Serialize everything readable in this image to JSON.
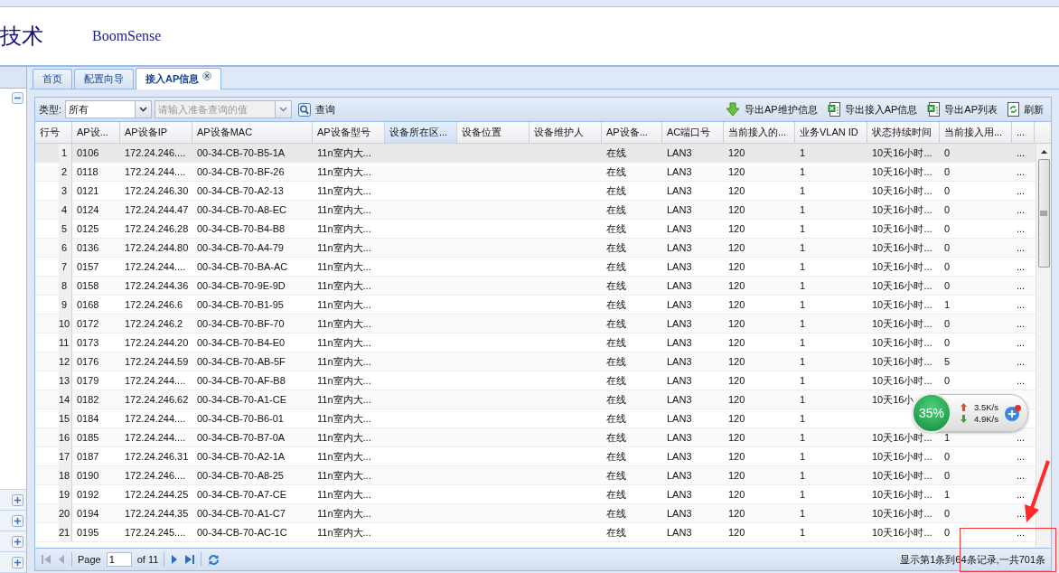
{
  "header": {
    "title": "技术",
    "brand": "BoomSense"
  },
  "sidebar": {
    "sections": [
      {
        "expanded": true
      },
      {
        "expanded": false
      },
      {
        "expanded": false
      },
      {
        "expanded": false
      },
      {
        "expanded": false
      }
    ]
  },
  "tabs": [
    {
      "label": "首页",
      "selected": false,
      "closable": false
    },
    {
      "label": "配置向导",
      "selected": false,
      "closable": false
    },
    {
      "label": "接入AP信息",
      "selected": true,
      "closable": true
    }
  ],
  "toolbar": {
    "type_label": "类型:",
    "type_value": "所有",
    "search_placeholder": "请输入准备查询的值",
    "search_button": "查询",
    "actions": [
      {
        "kind": "download",
        "label": "导出AP维护信息"
      },
      {
        "kind": "excel",
        "label": "导出接入AP信息"
      },
      {
        "kind": "excel",
        "label": "导出AP列表"
      },
      {
        "kind": "refresh",
        "label": "刷新"
      }
    ]
  },
  "table": {
    "columns": [
      {
        "label": "行号",
        "selected": false
      },
      {
        "label": "AP设...",
        "selected": false
      },
      {
        "label": "AP设备IP",
        "selected": false
      },
      {
        "label": "AP设备MAC",
        "selected": false
      },
      {
        "label": "AP设备型号",
        "selected": false
      },
      {
        "label": "设备所在区...",
        "selected": true
      },
      {
        "label": "设备位置",
        "selected": false
      },
      {
        "label": "设备维护人",
        "selected": false
      },
      {
        "label": "AP设备...",
        "selected": false
      },
      {
        "label": "AC端口号",
        "selected": false
      },
      {
        "label": "当前接入的...",
        "selected": false
      },
      {
        "label": "业务VLAN ID",
        "selected": false
      },
      {
        "label": "状态持续时间",
        "selected": false
      },
      {
        "label": "当前接入用...",
        "selected": false
      },
      {
        "label": "...",
        "selected": false
      }
    ],
    "rows": [
      {
        "row_number": "1",
        "selected": true,
        "ap_name": "0106",
        "ap_ip": "172.24.246....",
        "ap_mac": "00-34-CB-70-B5-1A",
        "ap_model": "11n室内大...",
        "status": "在线",
        "ac_port": "LAN3",
        "current_access": "120",
        "vlan_id": "1",
        "duration": "10天16小时...",
        "users": "0",
        "more": "..."
      },
      {
        "row_number": "2",
        "selected": false,
        "ap_name": "0118",
        "ap_ip": "172.24.244....",
        "ap_mac": "00-34-CB-70-BF-26",
        "ap_model": "11n室内大...",
        "status": "在线",
        "ac_port": "LAN3",
        "current_access": "120",
        "vlan_id": "1",
        "duration": "10天16小时...",
        "users": "0",
        "more": "..."
      },
      {
        "row_number": "3",
        "selected": false,
        "ap_name": "0121",
        "ap_ip": "172.24.246.30",
        "ap_mac": "00-34-CB-70-A2-13",
        "ap_model": "11n室内大...",
        "status": "在线",
        "ac_port": "LAN3",
        "current_access": "120",
        "vlan_id": "1",
        "duration": "10天16小时...",
        "users": "0",
        "more": "..."
      },
      {
        "row_number": "4",
        "selected": false,
        "ap_name": "0124",
        "ap_ip": "172.24.244.47",
        "ap_mac": "00-34-CB-70-A8-EC",
        "ap_model": "11n室内大...",
        "status": "在线",
        "ac_port": "LAN3",
        "current_access": "120",
        "vlan_id": "1",
        "duration": "10天16小时...",
        "users": "0",
        "more": "..."
      },
      {
        "row_number": "5",
        "selected": false,
        "ap_name": "0125",
        "ap_ip": "172.24.246.28",
        "ap_mac": "00-34-CB-70-B4-B8",
        "ap_model": "11n室内大...",
        "status": "在线",
        "ac_port": "LAN3",
        "current_access": "120",
        "vlan_id": "1",
        "duration": "10天16小时...",
        "users": "0",
        "more": "..."
      },
      {
        "row_number": "6",
        "selected": false,
        "ap_name": "0136",
        "ap_ip": "172.24.244.80",
        "ap_mac": "00-34-CB-70-A4-79",
        "ap_model": "11n室内大...",
        "status": "在线",
        "ac_port": "LAN3",
        "current_access": "120",
        "vlan_id": "1",
        "duration": "10天16小时...",
        "users": "0",
        "more": "..."
      },
      {
        "row_number": "7",
        "selected": false,
        "ap_name": "0157",
        "ap_ip": "172.24.244....",
        "ap_mac": "00-34-CB-70-BA-AC",
        "ap_model": "11n室内大...",
        "status": "在线",
        "ac_port": "LAN3",
        "current_access": "120",
        "vlan_id": "1",
        "duration": "10天16小时...",
        "users": "0",
        "more": "..."
      },
      {
        "row_number": "8",
        "selected": false,
        "ap_name": "0158",
        "ap_ip": "172.24.244.36",
        "ap_mac": "00-34-CB-70-9E-9D",
        "ap_model": "11n室内大...",
        "status": "在线",
        "ac_port": "LAN3",
        "current_access": "120",
        "vlan_id": "1",
        "duration": "10天16小时...",
        "users": "0",
        "more": "..."
      },
      {
        "row_number": "9",
        "selected": false,
        "ap_name": "0168",
        "ap_ip": "172.24.246.6",
        "ap_mac": "00-34-CB-70-B1-95",
        "ap_model": "11n室内大...",
        "status": "在线",
        "ac_port": "LAN3",
        "current_access": "120",
        "vlan_id": "1",
        "duration": "10天16小时...",
        "users": "1",
        "more": "..."
      },
      {
        "row_number": "10",
        "selected": false,
        "ap_name": "0172",
        "ap_ip": "172.24.246.2",
        "ap_mac": "00-34-CB-70-BF-70",
        "ap_model": "11n室内大...",
        "status": "在线",
        "ac_port": "LAN3",
        "current_access": "120",
        "vlan_id": "1",
        "duration": "10天16小时...",
        "users": "0",
        "more": "..."
      },
      {
        "row_number": "11",
        "selected": false,
        "ap_name": "0173",
        "ap_ip": "172.24.244.20",
        "ap_mac": "00-34-CB-70-B4-E0",
        "ap_model": "11n室内大...",
        "status": "在线",
        "ac_port": "LAN3",
        "current_access": "120",
        "vlan_id": "1",
        "duration": "10天16小时...",
        "users": "0",
        "more": "..."
      },
      {
        "row_number": "12",
        "selected": false,
        "ap_name": "0176",
        "ap_ip": "172.24.244.59",
        "ap_mac": "00-34-CB-70-AB-5F",
        "ap_model": "11n室内大...",
        "status": "在线",
        "ac_port": "LAN3",
        "current_access": "120",
        "vlan_id": "1",
        "duration": "10天16小时...",
        "users": "5",
        "more": "..."
      },
      {
        "row_number": "13",
        "selected": false,
        "ap_name": "0179",
        "ap_ip": "172.24.244....",
        "ap_mac": "00-34-CB-70-AF-B8",
        "ap_model": "11n室内大...",
        "status": "在线",
        "ac_port": "LAN3",
        "current_access": "120",
        "vlan_id": "1",
        "duration": "10天16小时...",
        "users": "0",
        "more": "..."
      },
      {
        "row_number": "14",
        "selected": false,
        "ap_name": "0182",
        "ap_ip": "172.24.246.62",
        "ap_mac": "00-34-CB-70-A1-CE",
        "ap_model": "11n室内大...",
        "status": "在线",
        "ac_port": "LAN3",
        "current_access": "120",
        "vlan_id": "1",
        "duration": "10天16小"
      },
      {
        "row_number": "15",
        "selected": false,
        "ap_name": "0184",
        "ap_ip": "172.24.244....",
        "ap_mac": "00-34-CB-70-B6-01",
        "ap_model": "11n室内大...",
        "status": "在线",
        "ac_port": "LAN3",
        "current_access": "120",
        "vlan_id": "1"
      },
      {
        "row_number": "16",
        "selected": false,
        "ap_name": "0185",
        "ap_ip": "172.24.244....",
        "ap_mac": "00-34-CB-70-B7-0A",
        "ap_model": "11n室内大...",
        "status": "在线",
        "ac_port": "LAN3",
        "current_access": "120",
        "vlan_id": "1",
        "duration": "10天16小时...",
        "users": "1",
        "more": "..."
      },
      {
        "row_number": "17",
        "selected": false,
        "ap_name": "0187",
        "ap_ip": "172.24.246.31",
        "ap_mac": "00-34-CB-70-A2-1A",
        "ap_model": "11n室内大...",
        "status": "在线",
        "ac_port": "LAN3",
        "current_access": "120",
        "vlan_id": "1",
        "duration": "10天16小时...",
        "users": "0",
        "more": "..."
      },
      {
        "row_number": "18",
        "selected": false,
        "ap_name": "0190",
        "ap_ip": "172.24.246....",
        "ap_mac": "00-34-CB-70-A8-25",
        "ap_model": "11n室内大...",
        "status": "在线",
        "ac_port": "LAN3",
        "current_access": "120",
        "vlan_id": "1",
        "duration": "10天16小时...",
        "users": "0",
        "more": "..."
      },
      {
        "row_number": "19",
        "selected": false,
        "ap_name": "0192",
        "ap_ip": "172.24.244.25",
        "ap_mac": "00-34-CB-70-A7-CE",
        "ap_model": "11n室内大...",
        "status": "在线",
        "ac_port": "LAN3",
        "current_access": "120",
        "vlan_id": "1",
        "duration": "10天16小时...",
        "users": "1",
        "more": "..."
      },
      {
        "row_number": "20",
        "selected": false,
        "ap_name": "0194",
        "ap_ip": "172.24.244.35",
        "ap_mac": "00-34-CB-70-A1-C7",
        "ap_model": "11n室内大...",
        "status": "在线",
        "ac_port": "LAN3",
        "current_access": "120",
        "vlan_id": "1",
        "duration": "10天16小时...",
        "users": "0",
        "more": "..."
      },
      {
        "row_number": "21",
        "selected": false,
        "ap_name": "0195",
        "ap_ip": "172.24.245....",
        "ap_mac": "00-34-CB-70-AC-1C",
        "ap_model": "11n室内大...",
        "status": "在线",
        "ac_port": "LAN3",
        "current_access": "120",
        "vlan_id": "1",
        "duration": "10天16小时...",
        "users": "0",
        "more": "..."
      }
    ]
  },
  "pager": {
    "page_label": "Page",
    "page_value": "1",
    "page_total": "of 11",
    "status": "显示第1条到64条记录,一共701条"
  },
  "speed_widget": {
    "percent": "35%",
    "upload": "3.5K/s",
    "download": "4.9K/s"
  }
}
